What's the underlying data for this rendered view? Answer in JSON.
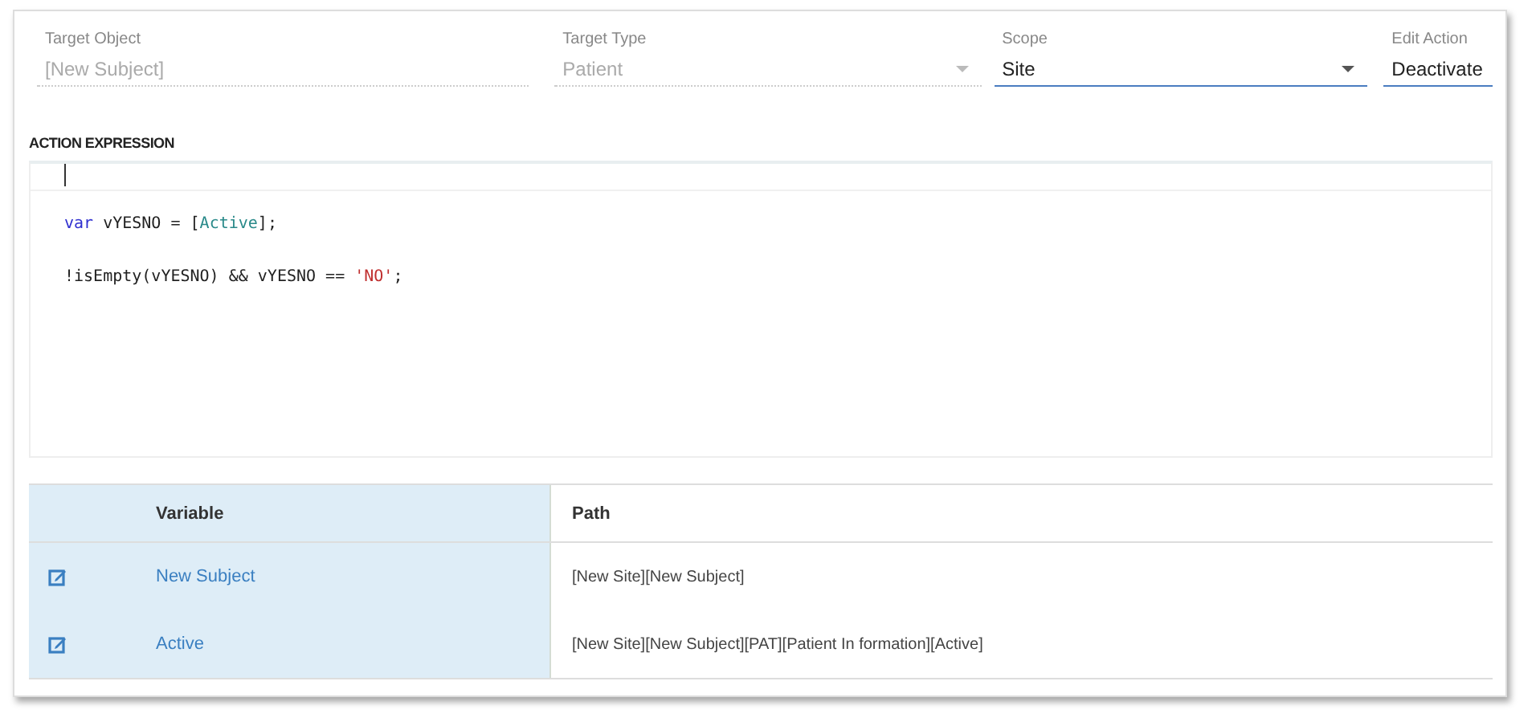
{
  "fields": [
    {
      "label": "Target Object",
      "value": "[New Subject]",
      "kind": "text",
      "disabled": true
    },
    {
      "label": "Target Type",
      "value": "Patient",
      "kind": "dropdown",
      "disabled": true
    },
    {
      "label": "Scope",
      "value": "Site",
      "kind": "dropdown",
      "disabled": false
    },
    {
      "label": "Edit Action",
      "value": "Deactivate",
      "kind": "text",
      "disabled": false
    }
  ],
  "action_expression": {
    "title": "ACTION EXPRESSION",
    "lines": [
      [
        {
          "text": "var",
          "kind": "keyword"
        },
        {
          "text": " vYESNO = [",
          "kind": "plain"
        },
        {
          "text": "Active",
          "kind": "reference"
        },
        {
          "text": "];",
          "kind": "plain"
        }
      ],
      [
        {
          "text": "!isEmpty(vYESNO) && vYESNO == ",
          "kind": "plain"
        },
        {
          "text": "'NO'",
          "kind": "string"
        },
        {
          "text": ";",
          "kind": "plain"
        }
      ]
    ]
  },
  "table": {
    "columns": [
      "Variable",
      "Path"
    ],
    "rows": [
      {
        "variable": "New Subject",
        "path": "[New Site][New Subject]"
      },
      {
        "variable": "Active",
        "path": "[New Site][New Subject][PAT][Patient In formation][Active]"
      }
    ]
  }
}
